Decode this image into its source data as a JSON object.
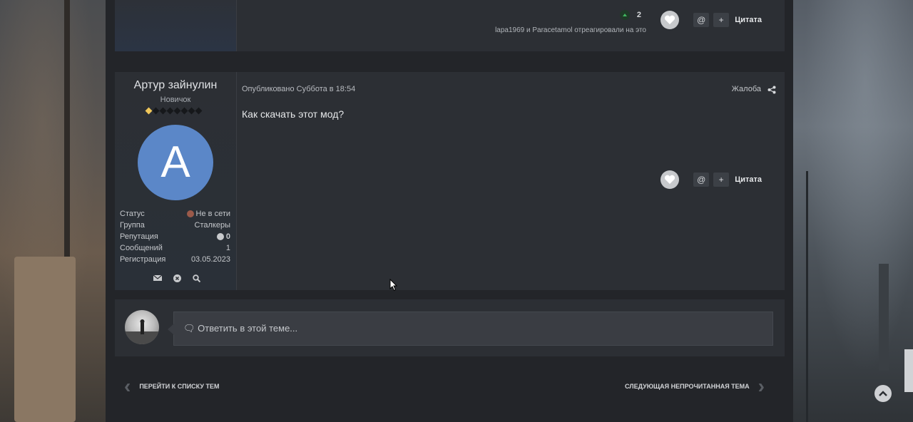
{
  "top_post": {
    "reaction_count": "2",
    "reacted_by": "lapa1969 и Paracetamol отреагировали на это",
    "quote_label": "Цитата",
    "mention_label": "@",
    "plus_label": "+"
  },
  "post": {
    "author_name": "Артур зайнулин",
    "author_rank": "Новичок",
    "avatar_letter": "A",
    "avatar_color": "#5b87c8",
    "published": "Опубликовано Суббота в 18:54",
    "report_label": "Жалоба",
    "content": "Как скачать этот мод?",
    "quote_label": "Цитата",
    "mention_label": "@",
    "plus_label": "+",
    "stats": [
      {
        "label": "Статус",
        "value": "Не в сети"
      },
      {
        "label": "Группа",
        "value": "Сталкеры"
      },
      {
        "label": "Репутация",
        "value": "0"
      },
      {
        "label": "Сообщений",
        "value": "1"
      },
      {
        "label": "Регистрация",
        "value": "03.05.2023"
      }
    ],
    "rank_pips_filled": 1,
    "rank_pips_total": 8
  },
  "reply": {
    "placeholder": "Ответить в этой теме..."
  },
  "pager": {
    "prev_label": "ПЕРЕЙТИ К СПИСКУ ТЕМ",
    "next_label": "СЛЕДУЮЩАЯ НЕПРОЧИТАННАЯ ТЕМА"
  },
  "colors": {
    "page_bg": "#232529",
    "panel_bg": "#2c2f34",
    "offline_dot": "#9b5a4a",
    "rank_pip": "#f0c75a"
  }
}
